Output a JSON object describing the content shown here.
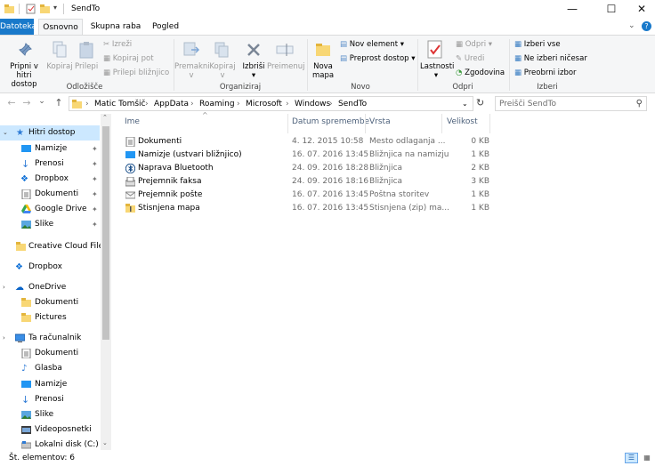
{
  "window": {
    "title": "SendTo",
    "minimize": "—",
    "maximize": "☐",
    "close": "✕"
  },
  "ribbon_tabs": [
    "Datoteka",
    "Osnovno",
    "Skupna raba",
    "Pogled"
  ],
  "ribbon": {
    "clipboard": {
      "pin_label_1": "Pripni v hitri",
      "pin_label_2": "dostop",
      "copy_label": "Kopiraj",
      "paste_label": "Prilepi",
      "cut_label": "Izreži",
      "copy_path_label": "Kopiraj pot",
      "paste_shortcut_label": "Prilepi bližnjico",
      "group_label": "Odložišče"
    },
    "organize": {
      "move_label_1": "Premakni",
      "move_label_2": "v",
      "copyto_label_1": "Kopiraj",
      "copyto_label_2": "v",
      "delete_label": "Izbriši",
      "rename_label": "Preimenuj",
      "group_label": "Organiziraj"
    },
    "new": {
      "new_folder_label_1": "Nova",
      "new_folder_label_2": "mapa",
      "new_item_label": "Nov element ▾",
      "easy_access_label": "Preprost dostop ▾",
      "group_label": "Novo"
    },
    "open": {
      "properties_label": "Lastnosti",
      "open_label": "Odpri ▾",
      "edit_label": "Uredi",
      "history_label": "Zgodovina",
      "group_label": "Odpri"
    },
    "select": {
      "select_all_label": "Izberi vse",
      "select_none_label": "Ne izberi ničesar",
      "invert_label": "Preobrni izbor",
      "group_label": "Izberi"
    }
  },
  "address": {
    "back": "←",
    "forward": "→",
    "recent": "⌄",
    "up": "↑",
    "breadcrumbs": [
      "Matic Tomšič",
      "AppData",
      "Roaming",
      "Microsoft",
      "Windows",
      "SendTo"
    ],
    "separator": "›",
    "search_placeholder": "Preišči SendTo"
  },
  "nav": {
    "items": [
      {
        "label": "Hitri dostop",
        "icon": "star-icon",
        "pinned": false
      },
      {
        "label": "Namizje",
        "icon": "desktop-icon",
        "pinned": true
      },
      {
        "label": "Prenosi",
        "icon": "download-icon",
        "pinned": true
      },
      {
        "label": "Dropbox",
        "icon": "dropbox-icon",
        "pinned": true
      },
      {
        "label": "Dokumenti",
        "icon": "documents-icon",
        "pinned": true
      },
      {
        "label": "Google Drive",
        "icon": "google-drive-icon",
        "pinned": true
      },
      {
        "label": "Slike",
        "icon": "pictures-icon",
        "pinned": true
      },
      {
        "label": "Creative Cloud Files",
        "icon": "creative-cloud-icon",
        "pinned": false
      },
      {
        "label": "Dropbox",
        "icon": "dropbox-icon",
        "pinned": false
      },
      {
        "label": "OneDrive",
        "icon": "onedrive-icon",
        "pinned": false
      },
      {
        "label": "Dokumenti",
        "icon": "folder-icon",
        "pinned": false
      },
      {
        "label": "Pictures",
        "icon": "folder-icon",
        "pinned": false
      },
      {
        "label": "Ta računalnik",
        "icon": "computer-icon",
        "pinned": false
      },
      {
        "label": "Dokumenti",
        "icon": "documents-icon",
        "pinned": false
      },
      {
        "label": "Glasba",
        "icon": "music-icon",
        "pinned": false
      },
      {
        "label": "Namizje",
        "icon": "desktop-icon",
        "pinned": false
      },
      {
        "label": "Prenosi",
        "icon": "download-icon",
        "pinned": false
      },
      {
        "label": "Slike",
        "icon": "pictures-icon",
        "pinned": false
      },
      {
        "label": "Videoposnetki",
        "icon": "video-icon",
        "pinned": false
      },
      {
        "label": "Lokalni disk (C:)",
        "icon": "drive-icon",
        "pinned": false
      }
    ],
    "pin_glyph": "📌"
  },
  "columns": {
    "name": "Ime",
    "date": "Datum spremembe",
    "type": "Vrsta",
    "size": "Velikost"
  },
  "files": [
    {
      "name": "Dokumenti",
      "date": "4. 12. 2015 10:58",
      "type": "Mesto odlaganja ...",
      "size": "0 KB",
      "icon": "document-folder-icon"
    },
    {
      "name": "Namizje (ustvari bližnjico)",
      "date": "16. 07. 2016 13:45",
      "type": "Bližnjica na namizju",
      "size": "1 KB",
      "icon": "desktop-shortcut-icon"
    },
    {
      "name": "Naprava Bluetooth",
      "date": "24. 09. 2016 18:28",
      "type": "Bližnjica",
      "size": "2 KB",
      "icon": "bluetooth-icon"
    },
    {
      "name": "Prejemnik faksa",
      "date": "24. 09. 2016 18:16",
      "type": "Bližnjica",
      "size": "3 KB",
      "icon": "fax-icon"
    },
    {
      "name": "Prejemnik pošte",
      "date": "16. 07. 2016 13:45",
      "type": "Poštna storitev",
      "size": "1 KB",
      "icon": "mail-icon"
    },
    {
      "name": "Stisnjena mapa",
      "date": "16. 07. 2016 13:45",
      "type": "Stisnjena (zip) ma...",
      "size": "1 KB",
      "icon": "zip-folder-icon"
    }
  ],
  "status": {
    "item_count": "Št. elementov: 6"
  },
  "colors": {
    "file_tab": "#1979ca",
    "selection": "#cce8ff",
    "folder": "#f8d775",
    "accent": "#0063b1"
  }
}
